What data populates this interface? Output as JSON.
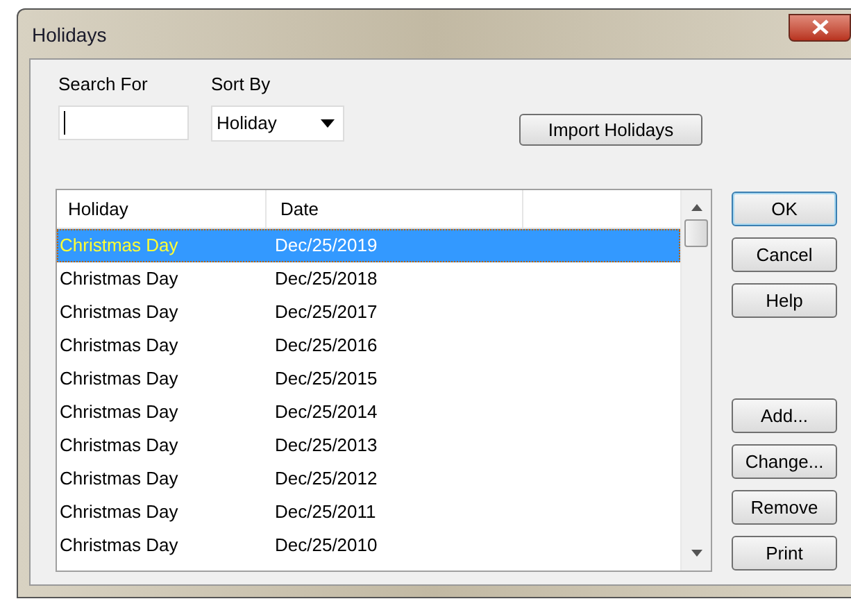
{
  "window": {
    "title": "Holidays"
  },
  "search": {
    "label": "Search For"
  },
  "sort": {
    "label": "Sort By",
    "value": "Holiday"
  },
  "import_button": "Import Holidays",
  "table": {
    "columns": [
      "Holiday",
      "Date"
    ],
    "rows": [
      {
        "holiday": "Christmas Day",
        "date": "Dec/25/2019",
        "selected": true
      },
      {
        "holiday": "Christmas Day",
        "date": "Dec/25/2018",
        "selected": false
      },
      {
        "holiday": "Christmas Day",
        "date": "Dec/25/2017",
        "selected": false
      },
      {
        "holiday": "Christmas Day",
        "date": "Dec/25/2016",
        "selected": false
      },
      {
        "holiday": "Christmas Day",
        "date": "Dec/25/2015",
        "selected": false
      },
      {
        "holiday": "Christmas Day",
        "date": "Dec/25/2014",
        "selected": false
      },
      {
        "holiday": "Christmas Day",
        "date": "Dec/25/2013",
        "selected": false
      },
      {
        "holiday": "Christmas Day",
        "date": "Dec/25/2012",
        "selected": false
      },
      {
        "holiday": "Christmas Day",
        "date": "Dec/25/2011",
        "selected": false
      },
      {
        "holiday": "Christmas Day",
        "date": "Dec/25/2010",
        "selected": false
      }
    ]
  },
  "buttons_top": [
    {
      "label": "OK",
      "default": true
    },
    {
      "label": "Cancel",
      "default": false
    },
    {
      "label": "Help",
      "default": false
    }
  ],
  "buttons_bottom": [
    "Add...",
    "Change...",
    "Remove",
    "Print"
  ]
}
